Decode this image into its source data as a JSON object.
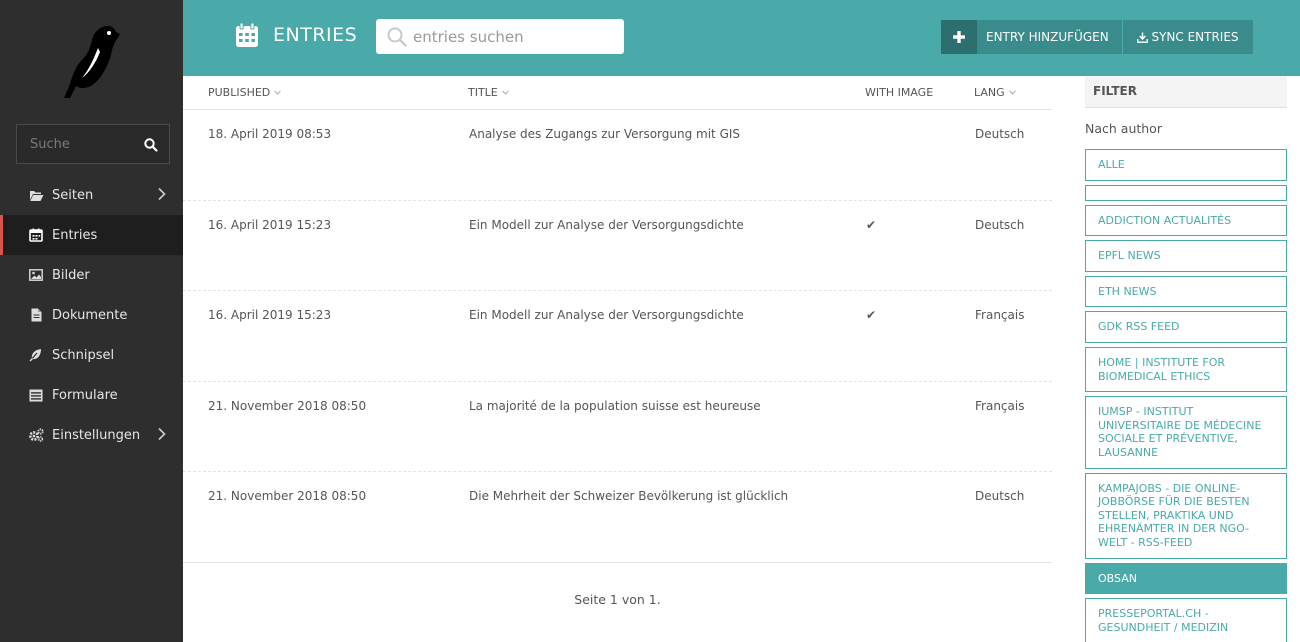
{
  "sidebar": {
    "search_placeholder": "Suche",
    "items": [
      {
        "label": "Seiten",
        "icon": "folder-open-icon",
        "has_submenu": true
      },
      {
        "label": "Entries",
        "icon": "calendar-icon",
        "active": true
      },
      {
        "label": "Bilder",
        "icon": "image-icon"
      },
      {
        "label": "Dokumente",
        "icon": "document-icon"
      },
      {
        "label": "Schnipsel",
        "icon": "leaf-icon"
      },
      {
        "label": "Formulare",
        "icon": "list-form-icon"
      },
      {
        "label": "Einstellungen",
        "icon": "cogs-icon",
        "has_submenu": true
      }
    ]
  },
  "header": {
    "title": "ENTRIES",
    "search_placeholder": "entries suchen",
    "add_label": "ENTRY HINZUFÜGEN",
    "sync_label": "SYNC ENTRIES"
  },
  "table": {
    "columns": [
      "PUBLISHED",
      "TITLE",
      "WITH IMAGE",
      "LANG"
    ],
    "rows": [
      {
        "published": "18. April 2019 08:53",
        "title": "Analyse des Zugangs zur Versorgung mit GIS",
        "with_image": "",
        "lang": "Deutsch"
      },
      {
        "published": "16. April 2019 15:23",
        "title": "Ein Modell zur Analyse der Versorgungsdichte",
        "with_image": "✔",
        "lang": "Deutsch"
      },
      {
        "published": "16. April 2019 15:23",
        "title": "Ein Modell zur Analyse der Versorgungsdichte",
        "with_image": "✔",
        "lang": "Français"
      },
      {
        "published": "21. November 2018 08:50",
        "title": "La majorité de la population suisse est heureuse",
        "with_image": "",
        "lang": "Français"
      },
      {
        "published": "21. November 2018 08:50",
        "title": "Die Mehrheit der Schweizer Bevölkerung ist glücklich",
        "with_image": "",
        "lang": "Deutsch"
      }
    ],
    "pagination": "Seite 1 von 1."
  },
  "filter": {
    "heading": "FILTER",
    "subheading": "Nach author",
    "options": [
      {
        "label": "ALLE"
      },
      {
        "label": ""
      },
      {
        "label": "ADDICTION ACTUALITÉS"
      },
      {
        "label": "EPFL NEWS"
      },
      {
        "label": "ETH NEWS"
      },
      {
        "label": "GDK RSS FEED"
      },
      {
        "label": "HOME | INSTITUTE FOR BIOMEDICAL ETHICS"
      },
      {
        "label": "IUMSP - INSTITUT UNIVERSITAIRE DE MÉDECINE SOCIALE ET PRÉVENTIVE, LAUSANNE"
      },
      {
        "label": "KAMPAJOBS - DIE ONLINE-JOBBÖRSE FÜR DIE BESTEN STELLEN, PRAKTIKA UND EHRENÄMTER IN DER NGO-WELT - RSS-FEED"
      },
      {
        "label": "OBSAN",
        "active": true
      },
      {
        "label": "PRESSEPORTAL.CH - GESUNDHEIT / MEDIZIN"
      }
    ]
  },
  "colors": {
    "accent": "#4aa9a9",
    "sidebar_bg": "#2e2e2e",
    "active_marker": "#d9534f"
  }
}
